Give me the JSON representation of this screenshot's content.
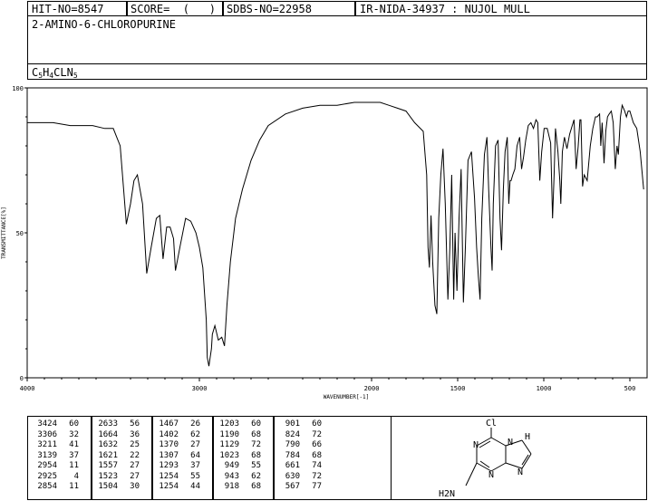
{
  "header": {
    "hit_no": "HIT-NO=8547",
    "score": "SCORE=  (   )",
    "sdbs_no": "SDBS-NO=22958",
    "ir_info": "IR-NIDA-34937 : NUJOL MULL",
    "compound_name": "2-AMINO-6-CHLOROPURINE",
    "formula_parts": [
      "C",
      "5",
      "H",
      "4",
      "CLN",
      "5"
    ]
  },
  "chart_data": {
    "type": "line",
    "title": "",
    "xlabel": "WAVENUMBER[-1]",
    "ylabel": "TRANSMITTANCE[%]",
    "xlim": [
      4000,
      400
    ],
    "ylim": [
      0,
      100
    ],
    "x_ticks": [
      4000,
      3000,
      2000,
      1500,
      1000,
      500
    ],
    "y_ticks": [
      0,
      50,
      100
    ],
    "grid": false,
    "x": [
      4000,
      3850,
      3750,
      3620,
      3550,
      3500,
      3460,
      3440,
      3424,
      3400,
      3380,
      3360,
      3330,
      3306,
      3280,
      3250,
      3230,
      3211,
      3190,
      3170,
      3150,
      3139,
      3110,
      3080,
      3050,
      3020,
      3000,
      2980,
      2960,
      2954,
      2945,
      2930,
      2925,
      2910,
      2890,
      2870,
      2854,
      2840,
      2820,
      2790,
      2750,
      2700,
      2650,
      2600,
      2500,
      2400,
      2300,
      2200,
      2100,
      2000,
      1950,
      1900,
      1850,
      1800,
      1750,
      1700,
      1680,
      1672,
      1664,
      1655,
      1645,
      1632,
      1625,
      1621,
      1610,
      1598,
      1585,
      1572,
      1557,
      1545,
      1535,
      1523,
      1515,
      1504,
      1492,
      1480,
      1467,
      1455,
      1440,
      1420,
      1402,
      1390,
      1380,
      1370,
      1360,
      1345,
      1330,
      1320,
      1307,
      1300,
      1293,
      1280,
      1265,
      1254,
      1245,
      1235,
      1225,
      1212,
      1203,
      1196,
      1190,
      1180,
      1168,
      1155,
      1140,
      1129,
      1118,
      1105,
      1090,
      1075,
      1060,
      1045,
      1035,
      1023,
      1012,
      998,
      980,
      960,
      949,
      940,
      932,
      918,
      907,
      901,
      892,
      880,
      865,
      850,
      835,
      824,
      812,
      800,
      790,
      784,
      775,
      765,
      748,
      730,
      715,
      700,
      690,
      676,
      669,
      661,
      650,
      640,
      630,
      620,
      608,
      597,
      585,
      575,
      567,
      555,
      545,
      530,
      520,
      510,
      500,
      480,
      460,
      440,
      420,
      400
    ],
    "y": [
      88,
      88,
      87,
      87,
      86,
      86,
      80,
      65,
      53,
      60,
      68,
      70,
      60,
      36,
      45,
      55,
      56,
      41,
      52,
      52,
      48,
      37,
      46,
      55,
      54,
      50,
      45,
      38,
      20,
      7,
      4,
      10,
      15,
      18,
      13,
      14,
      11,
      25,
      40,
      55,
      65,
      75,
      82,
      87,
      91,
      93,
      94,
      94,
      95,
      95,
      95,
      94,
      93,
      92,
      88,
      85,
      70,
      45,
      38,
      56,
      40,
      25,
      23,
      22,
      55,
      70,
      79,
      60,
      27,
      45,
      70,
      27,
      50,
      30,
      55,
      72,
      26,
      45,
      75,
      78,
      62,
      45,
      35,
      27,
      55,
      77,
      83,
      65,
      45,
      37,
      60,
      80,
      82,
      55,
      44,
      65,
      78,
      83,
      60,
      68,
      68,
      70,
      72,
      80,
      83,
      72,
      76,
      82,
      87,
      88,
      86,
      89,
      88,
      68,
      78,
      86,
      86,
      81,
      55,
      70,
      86,
      78,
      68,
      60,
      78,
      83,
      79,
      84,
      87,
      89,
      72,
      80,
      89,
      89,
      66,
      70,
      68,
      80,
      86,
      90,
      90,
      91,
      80,
      88,
      74,
      85,
      90,
      91,
      92,
      88,
      72,
      80,
      77,
      90,
      94,
      92,
      90,
      92,
      92,
      88,
      86,
      78,
      65
    ],
    "peak_table": [
      [
        [
          "3424",
          "60"
        ],
        [
          "3306",
          "32"
        ],
        [
          "3211",
          "41"
        ],
        [
          "3139",
          "37"
        ],
        [
          "2954",
          "11"
        ],
        [
          "2925",
          "4"
        ],
        [
          "2854",
          "11"
        ]
      ],
      [
        [
          "2633",
          "56"
        ],
        [
          "1664",
          "36"
        ],
        [
          "1632",
          "25"
        ],
        [
          "1621",
          "22"
        ],
        [
          "1557",
          "27"
        ],
        [
          "1523",
          "27"
        ],
        [
          "1504",
          "30"
        ]
      ],
      [
        [
          "1467",
          "26"
        ],
        [
          "1402",
          "62"
        ],
        [
          "1370",
          "27"
        ],
        [
          "1307",
          "64"
        ],
        [
          "1293",
          "37"
        ],
        [
          "1254",
          "55"
        ],
        [
          "1254",
          "44"
        ]
      ],
      [
        [
          "1203",
          "60"
        ],
        [
          "1190",
          "68"
        ],
        [
          "1129",
          "72"
        ],
        [
          "1023",
          "68"
        ],
        [
          "949",
          "55"
        ],
        [
          "943",
          "62"
        ],
        [
          "918",
          "68"
        ]
      ],
      [
        [
          "901",
          "60"
        ],
        [
          "824",
          "72"
        ],
        [
          "790",
          "66"
        ],
        [
          "784",
          "68"
        ],
        [
          "661",
          "74"
        ],
        [
          "630",
          "72"
        ],
        [
          "567",
          "77"
        ]
      ]
    ]
  },
  "structure": {
    "atom_labels": [
      "Cl",
      "N",
      "N",
      "N",
      "H",
      "N",
      "H2N"
    ],
    "line_color": "#000000"
  },
  "colors": {
    "foreground": "#000000",
    "background": "#ffffff"
  }
}
